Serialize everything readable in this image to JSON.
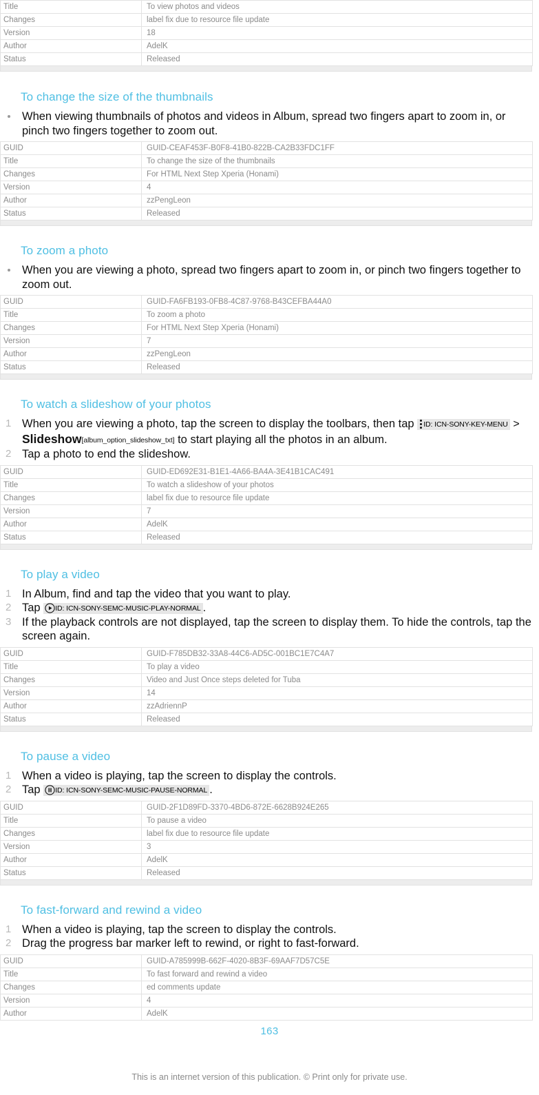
{
  "document": {
    "page_number": "163",
    "footer_note": "This is an internet version of this publication. © Print only for private use.",
    "accent_color": "#4fbfe3",
    "meta_label_keys": [
      "GUID",
      "Title",
      "Changes",
      "Version",
      "Author",
      "Status"
    ]
  },
  "top_table": {
    "rows": [
      {
        "key": "Title",
        "value": "To view photos and videos"
      },
      {
        "key": "Changes",
        "value": "label fix due to resource file update"
      },
      {
        "key": "Version",
        "value": "18"
      },
      {
        "key": "Author",
        "value": "AdelK"
      },
      {
        "key": "Status",
        "value": "Released"
      }
    ]
  },
  "sections": [
    {
      "heading": "To change the size of the thumbnails",
      "list_type": "bullet",
      "items": [
        "When viewing thumbnails of photos and videos in Album, spread two fingers apart to zoom in, or pinch two fingers together to zoom out."
      ],
      "table": {
        "rows": [
          {
            "key": "GUID",
            "value": "GUID-CEAF453F-B0F8-41B0-822B-CA2B33FDC1FF"
          },
          {
            "key": "Title",
            "value": "To change the size of the thumbnails"
          },
          {
            "key": "Changes",
            "value": "For HTML Next Step Xperia (Honami)"
          },
          {
            "key": "Version",
            "value": "4"
          },
          {
            "key": "Author",
            "value": "zzPengLeon"
          },
          {
            "key": "Status",
            "value": "Released"
          }
        ]
      }
    },
    {
      "heading": "To zoom a photo",
      "list_type": "bullet",
      "items": [
        "When you are viewing a photo, spread two fingers apart to zoom in, or pinch two fingers together to zoom out."
      ],
      "table": {
        "rows": [
          {
            "key": "GUID",
            "value": "GUID-FA6FB193-0FB8-4C87-9768-B43CEFBA44A0"
          },
          {
            "key": "Title",
            "value": "To zoom a photo"
          },
          {
            "key": "Changes",
            "value": "For HTML Next Step Xperia (Honami)"
          },
          {
            "key": "Version",
            "value": "7"
          },
          {
            "key": "Author",
            "value": "zzPengLeon"
          },
          {
            "key": "Status",
            "value": "Released"
          }
        ]
      }
    },
    {
      "heading": "To watch a slideshow of your photos",
      "list_type": "number",
      "items": [
        {
          "num": "1",
          "text_before": "When you are viewing a photo, tap the screen to display the toolbars, then tap",
          "icon_token": {
            "icon": "overflow-menu-icon",
            "id_text": "ID: ICN-SONY-KEY-MENU"
          },
          "separator": ">",
          "ui_term": "Slideshow",
          "resource_key": "[album_option_slideshow_txt]",
          "text_after": "to start playing all the photos in an album."
        },
        {
          "num": "2",
          "text_before": "Tap a photo to end the slideshow."
        }
      ],
      "table": {
        "rows": [
          {
            "key": "GUID",
            "value": "GUID-ED692E31-B1E1-4A66-BA4A-3E41B1CAC491"
          },
          {
            "key": "Title",
            "value": "To watch a slideshow of your photos"
          },
          {
            "key": "Changes",
            "value": "label fix due to resource file update"
          },
          {
            "key": "Version",
            "value": "7"
          },
          {
            "key": "Author",
            "value": "AdelK"
          },
          {
            "key": "Status",
            "value": "Released"
          }
        ]
      }
    },
    {
      "heading": "To play a video",
      "list_type": "number",
      "items": [
        {
          "num": "1",
          "text_before": "In Album, find and tap the video that you want to play."
        },
        {
          "num": "2",
          "text_before": "Tap",
          "icon_token": {
            "icon": "play-circle-icon",
            "id_text": "ID: ICN-SONY-SEMC-MUSIC-PLAY-NORMAL"
          },
          "text_after": "."
        },
        {
          "num": "3",
          "text_before": "If the playback controls are not displayed, tap the screen to display them. To hide the controls, tap the screen again."
        }
      ],
      "table": {
        "rows": [
          {
            "key": "GUID",
            "value": "GUID-F785DB32-33A8-44C6-AD5C-001BC1E7C4A7"
          },
          {
            "key": "Title",
            "value": "To play a video"
          },
          {
            "key": "Changes",
            "value": "Video and Just Once steps deleted for Tuba"
          },
          {
            "key": "Version",
            "value": "14"
          },
          {
            "key": "Author",
            "value": "zzAdriennP"
          },
          {
            "key": "Status",
            "value": "Released"
          }
        ]
      }
    },
    {
      "heading": "To pause a video",
      "list_type": "number",
      "items": [
        {
          "num": "1",
          "text_before": "When a video is playing, tap the screen to display the controls."
        },
        {
          "num": "2",
          "text_before": "Tap",
          "icon_token": {
            "icon": "pause-circle-icon",
            "id_text": "ID: ICN-SONY-SEMC-MUSIC-PAUSE-NORMAL"
          },
          "text_after": "."
        }
      ],
      "table": {
        "rows": [
          {
            "key": "GUID",
            "value": "GUID-2F1D89FD-3370-4BD6-872E-6628B924E265"
          },
          {
            "key": "Title",
            "value": "To pause a video"
          },
          {
            "key": "Changes",
            "value": "label fix due to resource file update"
          },
          {
            "key": "Version",
            "value": "3"
          },
          {
            "key": "Author",
            "value": "AdelK"
          },
          {
            "key": "Status",
            "value": "Released"
          }
        ]
      }
    },
    {
      "heading": "To fast-forward and rewind a video",
      "list_type": "number",
      "items": [
        {
          "num": "1",
          "text_before": "When a video is playing, tap the screen to display the controls."
        },
        {
          "num": "2",
          "text_before": "Drag the progress bar marker left to rewind, or right to fast-forward."
        }
      ],
      "table": {
        "rows": [
          {
            "key": "GUID",
            "value": "GUID-A785999B-662F-4020-8B3F-69AAF7D57C5E"
          },
          {
            "key": "Title",
            "value": "To fast forward and rewind a video"
          },
          {
            "key": "Changes",
            "value": "ed comments update"
          },
          {
            "key": "Version",
            "value": "4"
          },
          {
            "key": "Author",
            "value": "AdelK"
          }
        ]
      }
    }
  ]
}
